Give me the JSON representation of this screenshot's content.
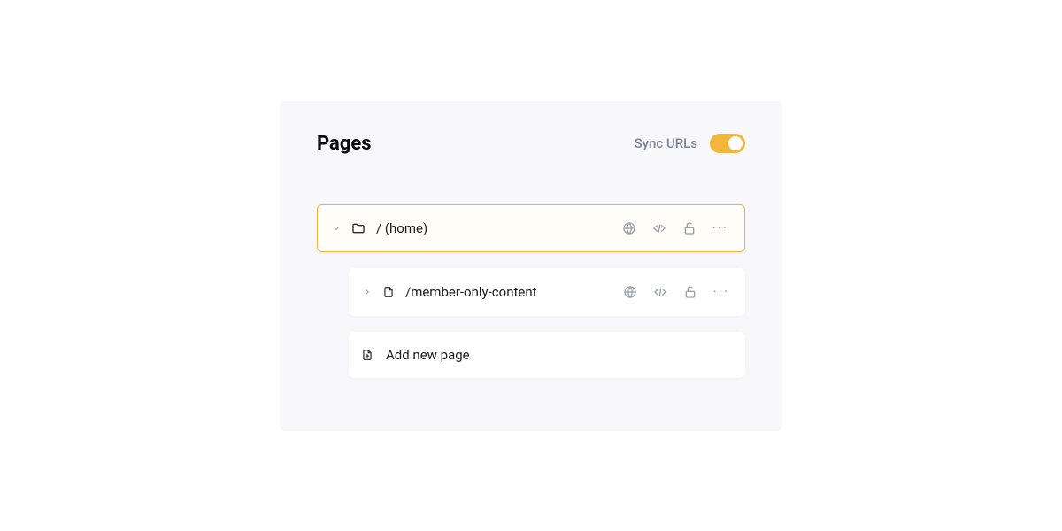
{
  "header": {
    "title": "Pages",
    "sync_label": "Sync URLs",
    "sync_enabled": true
  },
  "rows": [
    {
      "label": "/ (home)",
      "selected": true,
      "expanded": true,
      "type": "folder",
      "depth": 0
    },
    {
      "label": "/member-only-content",
      "selected": false,
      "expanded": false,
      "type": "page",
      "depth": 1
    }
  ],
  "add_page_label": "Add new page"
}
